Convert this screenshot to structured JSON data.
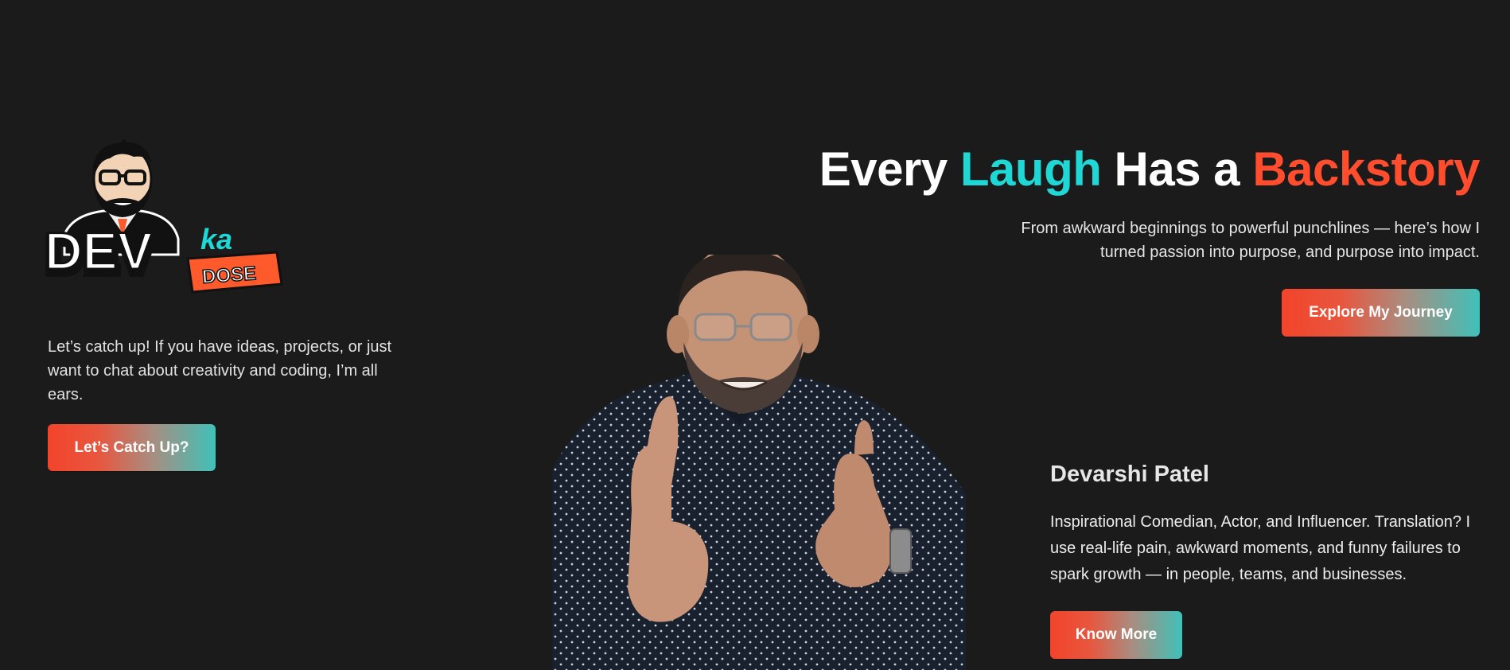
{
  "logo": {
    "word_dev": "DEV",
    "word_ka": "ka",
    "word_dose": "DOSE"
  },
  "intro": {
    "text": "Let’s catch up! If you have ideas, projects, or just want to chat about creativity and coding, I’m all ears.",
    "cta_label": "Let’s Catch Up?"
  },
  "hero": {
    "title_part1": "Every ",
    "title_laugh": "Laugh",
    "title_part2": " Has a ",
    "title_backstory": "Backstory",
    "subtitle": "From awkward beginnings to powerful punchlines — here’s how I turned passion into purpose, and purpose into impact.",
    "cta_label": "Explore My Journey"
  },
  "bio": {
    "name": "Devarshi Patel",
    "description": "Inspirational Comedian, Actor, and Influencer. Translation? I use real-life pain, awkward moments, and funny failures to spark growth — in people, teams, and businesses.",
    "cta_label": "Know More"
  },
  "colors": {
    "background": "#1b1b1c",
    "accent_cyan": "#1fd8d6",
    "accent_orange": "#ff4d2e",
    "button_gradient_start": "#f2442b",
    "button_gradient_end": "#3fc1b9"
  },
  "icons": {
    "logo": "dev-ka-dose-logo-caricature",
    "photo": "person-pointing-photo"
  }
}
